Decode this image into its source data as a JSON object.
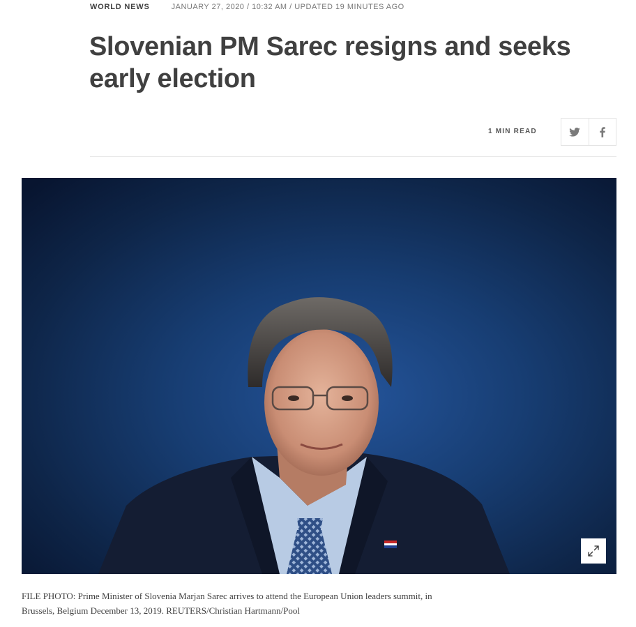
{
  "article": {
    "section": "WORLD NEWS",
    "dateline": "JANUARY 27, 2020 / 10:32 AM / UPDATED 19 MINUTES AGO",
    "headline": "Slovenian PM Sarec resigns and seeks early election",
    "read_time": "1 MIN READ"
  },
  "share": {
    "twitter_icon": "twitter-icon",
    "facebook_icon": "facebook-icon"
  },
  "photo": {
    "expand_icon": "expand-icon",
    "caption": "FILE PHOTO: Prime Minister of Slovenia Marjan Sarec arrives to attend the European Union leaders summit, in Brussels, Belgium December 13, 2019. REUTERS/Christian Hartmann/Pool"
  },
  "colors": {
    "text": "#404040",
    "muted": "#777777",
    "photo_background": "#173a6b"
  }
}
